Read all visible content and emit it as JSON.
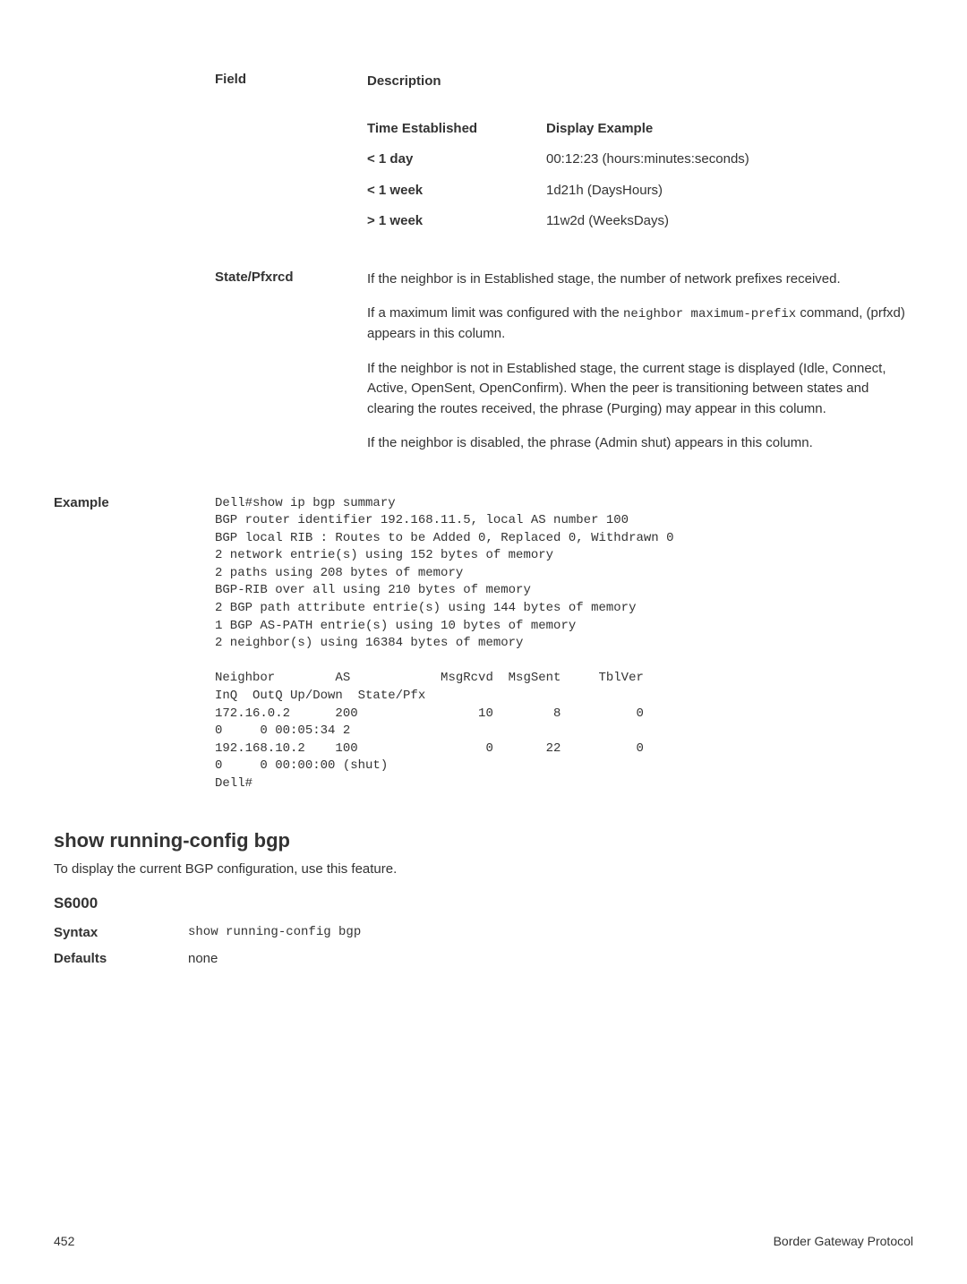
{
  "field_table": {
    "header_field": "Field",
    "header_desc": "Description",
    "row1": {
      "label": "",
      "inner": {
        "th_time": "Time Established",
        "th_display": "Display Example",
        "r1_time": "< 1 day",
        "r1_display": "00:12:23 (hours:minutes:seconds)",
        "r2_time": "< 1 week",
        "r2_display": "1d21h (DaysHours)",
        "r3_time": "> 1 week",
        "r3_display": "11w2d (WeeksDays)"
      }
    },
    "row2": {
      "label": "State/Pfxrcd",
      "p1_pre": "If the neighbor is in Established stage, the number of network prefixes received.",
      "p2_pre": "If a maximum limit was configured with the ",
      "p2_code1": "neighbor maximum-prefix",
      "p2_mid": " command, (prfxd) appears in this column.",
      "p3": "If the neighbor is not in Established stage, the current stage is displayed (Idle, Connect, Active, OpenSent, OpenConfirm). When the peer is transitioning between states and clearing the routes received, the phrase (Purging) may appear in this column.",
      "p4": "If the neighbor is disabled, the phrase (Admin shut) appears in this column."
    }
  },
  "example": {
    "label": "Example",
    "text": "Dell#show ip bgp summary\nBGP router identifier 192.168.11.5, local AS number 100\nBGP local RIB : Routes to be Added 0, Replaced 0, Withdrawn 0\n2 network entrie(s) using 152 bytes of memory\n2 paths using 208 bytes of memory\nBGP-RIB over all using 210 bytes of memory\n2 BGP path attribute entrie(s) using 144 bytes of memory\n1 BGP AS-PATH entrie(s) using 10 bytes of memory\n2 neighbor(s) using 16384 bytes of memory\n\nNeighbor        AS            MsgRcvd  MsgSent     TblVer  \nInQ  OutQ Up/Down  State/Pfx\n172.16.0.2      200                10        8          0  \n0     0 00:05:34 2\n192.168.10.2    100                 0       22          0  \n0     0 00:00:00 (shut)\nDell#"
  },
  "section": {
    "heading": "show running-config bgp",
    "desc": "To display the current BGP configuration, use this feature.",
    "subheading": "S6000",
    "syntax_label": "Syntax",
    "syntax_value": "show running-config bgp",
    "defaults_label": "Defaults",
    "defaults_value": "none"
  },
  "footer": {
    "page": "452",
    "title": "Border Gateway Protocol"
  }
}
